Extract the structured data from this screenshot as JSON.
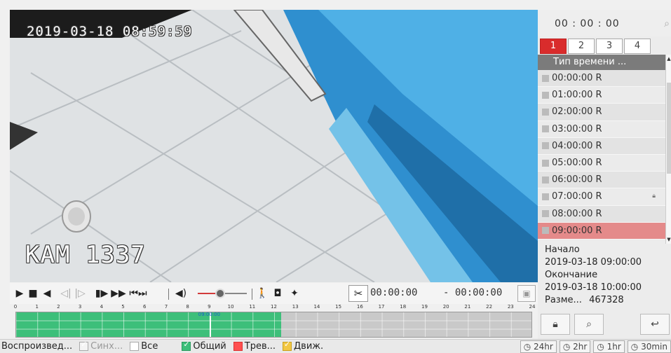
{
  "video": {
    "osd_datetime": "2019-03-18 08:59:59",
    "osd_camera": "КАМ 1337"
  },
  "controls": {
    "icons": [
      "play-icon",
      "stop-icon",
      "reverse-icon",
      "frame-back-icon",
      "frame-forward-icon",
      "slow-icon",
      "fast-forward-icon",
      "skip-icon",
      "volume-icon",
      "person-icon",
      "camera-icon",
      "pin-icon",
      "scissors-icon",
      "save-icon"
    ],
    "volume_level": 0.45,
    "clip_start": "00:00:00",
    "clip_end": "- 00:00:00"
  },
  "timeline": {
    "ticks": [
      "0",
      "1",
      "2",
      "3",
      "4",
      "5",
      "6",
      "7",
      "8",
      "9",
      "10",
      "11",
      "12",
      "13",
      "14",
      "15",
      "16",
      "17",
      "18",
      "19",
      "20",
      "21",
      "22",
      "23",
      "24"
    ],
    "recorded_until_hour": 12.3,
    "cursor_hour": 9,
    "cursor_label": "09:00:00",
    "record_color": "#3dbf7a"
  },
  "statusbar": {
    "playback": "Воспроизвед...",
    "sync": "Синх...",
    "all": "Все",
    "general": "Общий",
    "alarm": "Трев...",
    "motion": "Движ.",
    "zoom": [
      "24hr",
      "2hr",
      "1hr",
      "30min"
    ]
  },
  "panel": {
    "time": "00 : 00 : 00",
    "tabs": [
      "1",
      "2",
      "3",
      "4"
    ],
    "active_tab": 0,
    "list_header": "Тип времени ...",
    "files": [
      {
        "time": "00:00:00 R",
        "locked": false
      },
      {
        "time": "01:00:00 R",
        "locked": false
      },
      {
        "time": "02:00:00 R",
        "locked": false
      },
      {
        "time": "03:00:00 R",
        "locked": false
      },
      {
        "time": "04:00:00 R",
        "locked": false
      },
      {
        "time": "05:00:00 R",
        "locked": false
      },
      {
        "time": "06:00:00 R",
        "locked": false
      },
      {
        "time": "07:00:00 R",
        "locked": true
      },
      {
        "time": "08:00:00 R",
        "locked": false
      },
      {
        "time": "09:00:00 R",
        "locked": false,
        "selected": true
      }
    ],
    "info": {
      "start_label": "Начало",
      "start_value": "2019-03-18 09:00:00",
      "end_label": "Окончание",
      "end_value": "2019-03-18 10:00:00",
      "size_label": "Разме...",
      "size_value": "467328"
    },
    "selected_color": "#e48a8a",
    "accent": "#d92c2c"
  }
}
